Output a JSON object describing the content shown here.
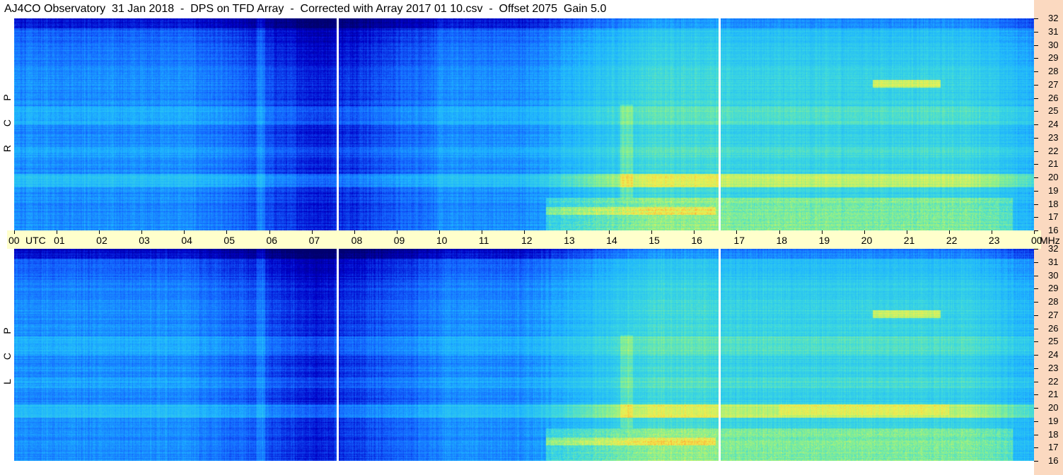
{
  "title": "AJ4CO Observatory  31 Jan 2018  -  DPS on TFD Array  -  Corrected with Array 2017 01 10.csv  -  Offset 2075  Gain 5.0",
  "chart_data": {
    "type": "heatmap",
    "panels": [
      {
        "label": "R C P",
        "letters": [
          "R",
          "C",
          "P"
        ]
      },
      {
        "label": "L C P",
        "letters": [
          "L",
          "C",
          "P"
        ]
      }
    ],
    "x_axis": {
      "ticks": [
        "00",
        "01",
        "02",
        "03",
        "04",
        "05",
        "06",
        "07",
        "08",
        "09",
        "10",
        "11",
        "12",
        "13",
        "14",
        "15",
        "16",
        "17",
        "18",
        "19",
        "20",
        "21",
        "22",
        "23",
        "00"
      ],
      "utc_label": "UTC",
      "unit_label": "MHz",
      "range": [
        0,
        24
      ]
    },
    "y_axis": {
      "ticks": [
        "16",
        "17",
        "18",
        "19",
        "20",
        "21",
        "22",
        "23",
        "24",
        "25",
        "26",
        "27",
        "28",
        "29",
        "30",
        "31",
        "32"
      ],
      "range": [
        16,
        32
      ]
    },
    "vertical_markers_utc": [
      7.6,
      16.6
    ],
    "colormap": [
      "#00006e",
      "#0000c8",
      "#1464ff",
      "#1eb4ff",
      "#3cd8e0",
      "#8cf08c",
      "#f0f050",
      "#ff9a30",
      "#ff2a6a",
      "#ffffff"
    ],
    "background": "#ffffcc",
    "gutter_color": "#fbd9c0"
  }
}
